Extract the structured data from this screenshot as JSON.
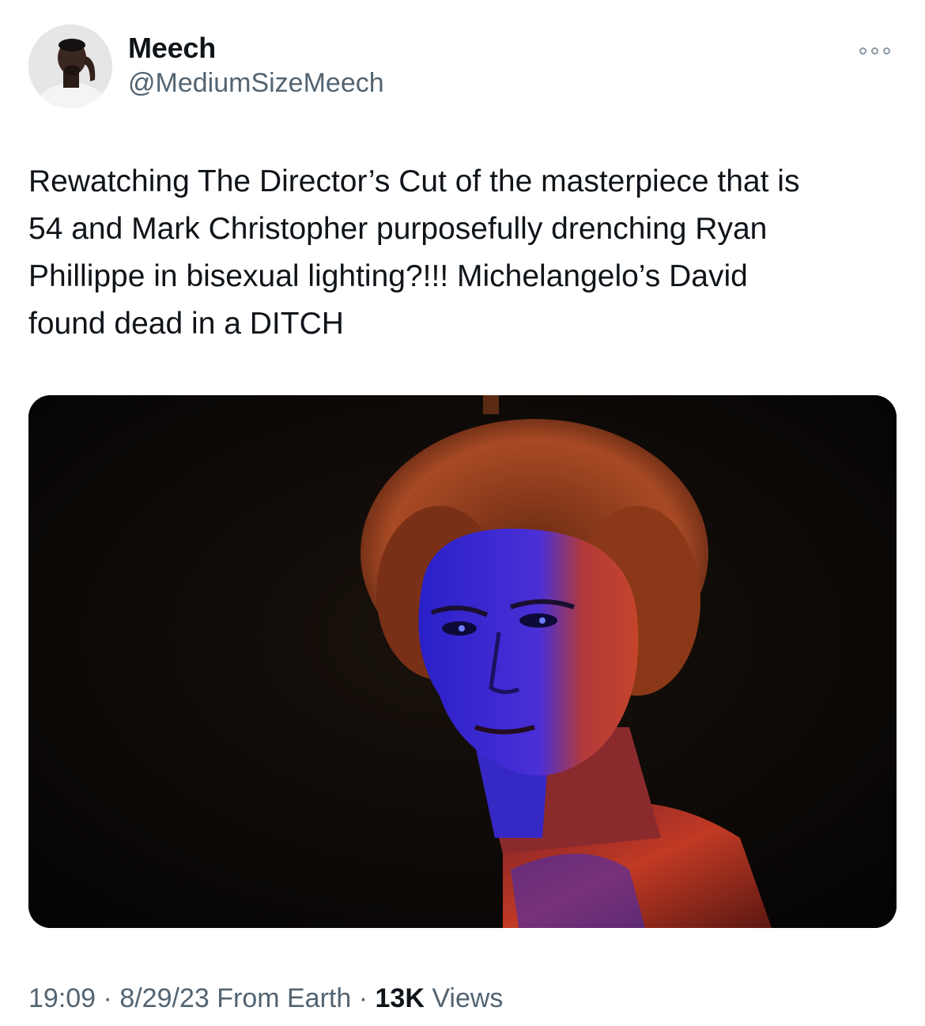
{
  "tweet": {
    "author": {
      "display_name": "Meech",
      "handle": "@MediumSizeMeech",
      "avatar_icon": "profile-photo"
    },
    "more_icon": "more-horizontal-icon",
    "text": "Rewatching The Director’s Cut of the masterpiece that is\n54 and Mark Christopher purposefully drenching Ryan\nPhillippe in bisexual lighting?!!! Michelangelo’s David\nfound dead in a DITCH",
    "media": {
      "kind": "photo"
    },
    "meta": {
      "time": "19:09",
      "separator": "·",
      "date": "8/29/23",
      "source": "From Earth",
      "views_count": "13K",
      "views_label": "Views"
    }
  },
  "colors": {
    "text_primary": "#0f1419",
    "text_secondary": "#536471",
    "more_dots": "#8b98a5",
    "photo_red": "#c03a24",
    "photo_blue": "#3a2fd0"
  }
}
